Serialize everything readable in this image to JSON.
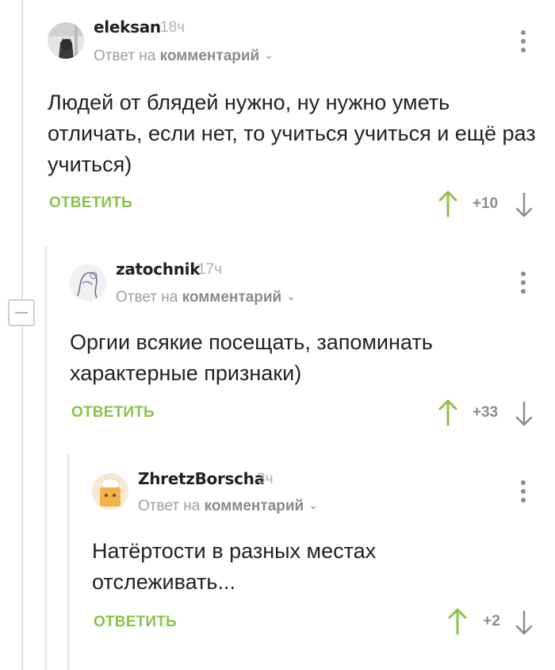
{
  "comments": [
    {
      "author": "eleksan",
      "time": "18ч",
      "reply_prefix": "Ответ на",
      "reply_target": "комментарий",
      "text": "Людей от блядей нужно, ну нужно уметь отличать, если нет, то учиться учиться и ещё раз учиться)",
      "reply_label": "ОТВЕТИТЬ",
      "score": "+10"
    },
    {
      "author": "zatochnik",
      "time": "17ч",
      "reply_prefix": "Ответ на",
      "reply_target": "комментарий",
      "text": "Оргии всякие посещать, запоминать характерные признаки)",
      "reply_label": "ОТВЕТИТЬ",
      "score": "+33"
    },
    {
      "author": "ZhretzBorscha",
      "time": "3ч",
      "reply_prefix": "Ответ на",
      "reply_target": "комментарий",
      "text": "Натёртости в разных местах отслеживать...",
      "reply_label": "ОТВЕТИТЬ",
      "score": "+2"
    }
  ],
  "icons": {
    "collapse": "minus-icon",
    "menu": "more-vertical-icon",
    "upvote": "arrow-up-icon",
    "downvote": "arrow-down-icon",
    "dropdown": "chevron-down-icon"
  },
  "colors": {
    "accent_green": "#8bc24a",
    "thread_line": "#e3e3e3",
    "muted_text": "#9e9e9e"
  }
}
